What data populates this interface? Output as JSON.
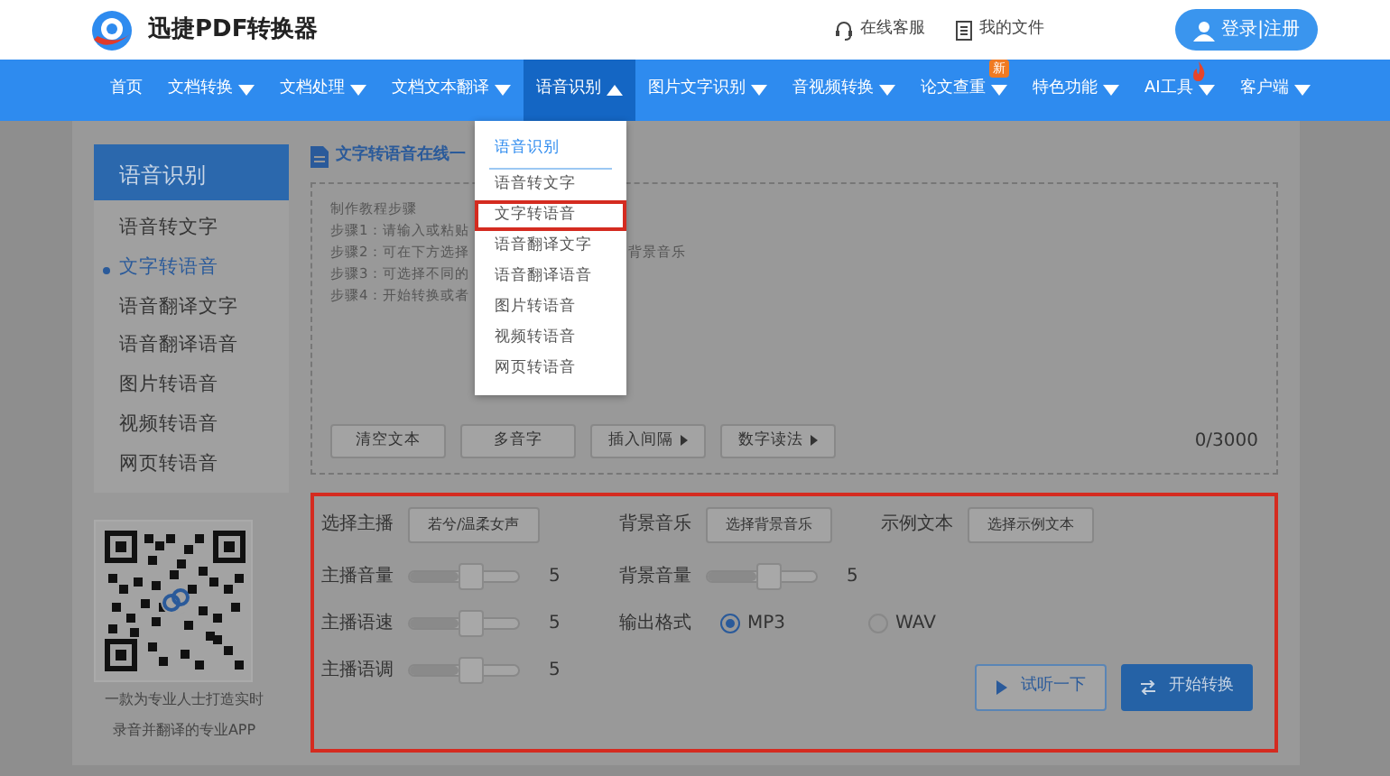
{
  "header": {
    "logo_text": "迅捷PDF转换器",
    "links": [
      {
        "label": "在线客服",
        "kind": "headset"
      },
      {
        "label": "我的文件",
        "kind": "file"
      }
    ],
    "login_button": "登录|注册"
  },
  "nav": {
    "items": [
      {
        "label": "首页",
        "has_caret": false,
        "selected": false,
        "hot": false
      },
      {
        "label": "文档转换",
        "has_caret": true,
        "selected": false,
        "hot": false
      },
      {
        "label": "文档处理",
        "has_caret": true,
        "selected": false,
        "hot": false
      },
      {
        "label": "文档文本翻译",
        "has_caret": true,
        "selected": false,
        "hot": false
      },
      {
        "label": "语音识别",
        "has_caret": true,
        "selected": true,
        "hot": false
      },
      {
        "label": "图片文字识别",
        "has_caret": true,
        "selected": false,
        "hot": false
      },
      {
        "label": "音视频转换",
        "has_caret": true,
        "selected": false,
        "hot": false
      },
      {
        "label": "论文查重",
        "has_caret": true,
        "selected": false,
        "hot": false,
        "badge": "新"
      },
      {
        "label": "特色功能",
        "has_caret": true,
        "selected": false,
        "hot": false
      },
      {
        "label": "AI工具",
        "has_caret": true,
        "selected": false,
        "hot": true
      },
      {
        "label": "客户端",
        "has_caret": true,
        "selected": false,
        "hot": false
      }
    ]
  },
  "dropdown": {
    "heading": "语音识别",
    "items": [
      {
        "label": "语音转文字",
        "highlighted": false
      },
      {
        "label": "文字转语音",
        "highlighted": true
      },
      {
        "label": "语音翻译文字",
        "highlighted": false
      },
      {
        "label": "语音翻译语音",
        "highlighted": false
      },
      {
        "label": "图片转语音",
        "highlighted": false
      },
      {
        "label": "视频转语音",
        "highlighted": false
      },
      {
        "label": "网页转语音",
        "highlighted": false
      }
    ]
  },
  "sidebar": {
    "title": "语音识别",
    "items": [
      {
        "label": "语音转文字",
        "selected": false
      },
      {
        "label": "文字转语音",
        "selected": true
      },
      {
        "label": "语音翻译文字",
        "selected": false
      },
      {
        "label": "语音翻译语音",
        "selected": false
      },
      {
        "label": "图片转语音",
        "selected": false
      },
      {
        "label": "视频转语音",
        "selected": false
      },
      {
        "label": "网页转语音",
        "selected": false
      }
    ],
    "qr_caption": [
      "一款为专业人士打造实时",
      "录音并翻译的专业APP"
    ]
  },
  "main": {
    "title": "文字转语音在线一",
    "instructions": [
      {
        "text": "制作教程步骤"
      },
      {
        "text": "步骤1：请输入或粘贴"
      },
      {
        "text": "步骤2：可在下方选择",
        "tail": "背景音乐"
      },
      {
        "text": "步骤3：可选择不同的"
      },
      {
        "text": "步骤4：开始转换或者"
      }
    ],
    "tools": [
      {
        "label": "清空文本",
        "has_arrow": false
      },
      {
        "label": "多音字",
        "has_arrow": false
      },
      {
        "label": "插入间隔",
        "has_arrow": true
      },
      {
        "label": "数字读法",
        "has_arrow": true
      }
    ],
    "counter": "0/3000"
  },
  "settings": {
    "highlighted": true,
    "anchor": {
      "label": "选择主播",
      "button": "若兮/温柔女声"
    },
    "music": {
      "label": "背景音乐",
      "button": "选择背景音乐"
    },
    "sample": {
      "label": "示例文本",
      "button": "选择示例文本"
    },
    "sliders": [
      {
        "label": "主播音量",
        "level": 0.45,
        "reading": "5"
      },
      {
        "label": "主播语速",
        "level": 0.45,
        "reading": "5"
      },
      {
        "label": "主播语调",
        "level": 0.45,
        "reading": "5"
      }
    ],
    "music_volume": {
      "label": "背景音量",
      "level": 0.45,
      "reading": "5"
    },
    "format": {
      "label": "输出格式",
      "options": [
        {
          "label": "MP3",
          "selected": true
        },
        {
          "label": "WAV",
          "selected": false
        }
      ]
    },
    "preview_button": "试听一下",
    "convert_button": "开始转换"
  }
}
